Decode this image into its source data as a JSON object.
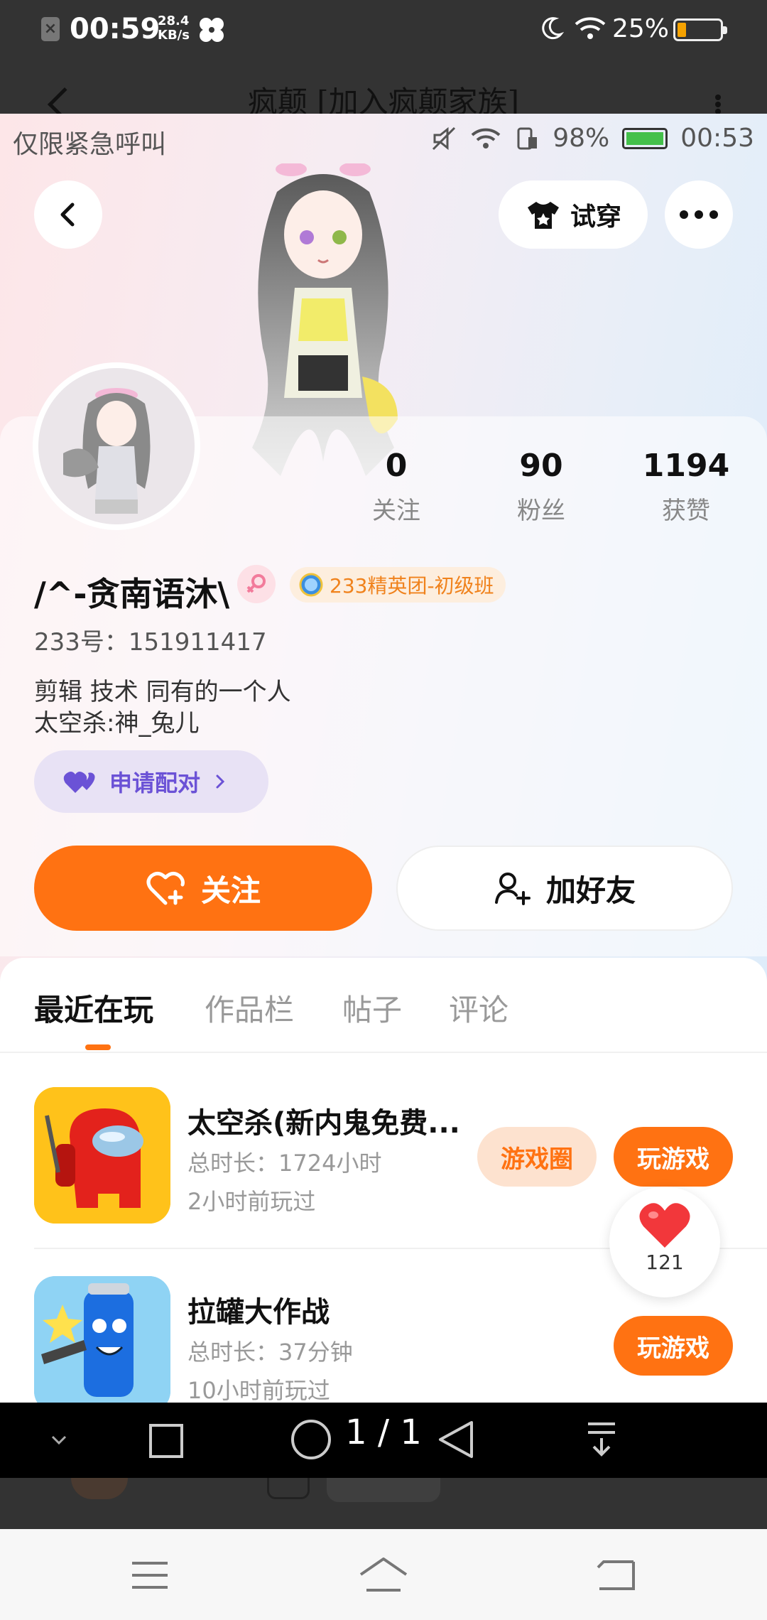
{
  "outer_status": {
    "time": "00:59",
    "speed_value": "28.4",
    "speed_unit": "KB/s",
    "battery_pct": "25%"
  },
  "outer_header": {
    "title": "疯颠  [加入疯颠家族]"
  },
  "inner_status": {
    "emergency": "仅限紧急呼叫",
    "battery_pct": "98%",
    "time": "00:53"
  },
  "top_actions": {
    "try_on": "试穿"
  },
  "stats": [
    {
      "value": "0",
      "label": "关注"
    },
    {
      "value": "90",
      "label": "粉丝"
    },
    {
      "value": "1194",
      "label": "获赞"
    }
  ],
  "profile": {
    "username": "/^-贪南语沐\\",
    "badge": "233精英团-初级班",
    "uid": "233号：151911417",
    "bio_line1": "剪辑   技术   同有的一个人",
    "bio_line2": "太空杀:神_兔儿",
    "pair_button": "申请配对"
  },
  "actions": {
    "follow": "关注",
    "add_friend": "加好友"
  },
  "tabs": [
    {
      "label": "最近在玩",
      "active": true
    },
    {
      "label": "作品栏",
      "active": false
    },
    {
      "label": "帖子",
      "active": false
    },
    {
      "label": "评论",
      "active": false
    }
  ],
  "games": [
    {
      "title": "太空杀(新内鬼免费...",
      "duration": "总时长：1724小时",
      "last_played": "2小时前玩过",
      "circle_button": "游戏圈",
      "play_button": "玩游戏"
    },
    {
      "title": "拉罐大作战",
      "duration": "总时长：37分钟",
      "last_played": "10小时前玩过",
      "play_button": "玩游戏"
    }
  ],
  "like_fab": {
    "count": "121"
  },
  "viewer": {
    "page_indicator": "1 / 1"
  },
  "colors": {
    "accent": "#ff7212",
    "pair_purple": "#6b52d6"
  }
}
